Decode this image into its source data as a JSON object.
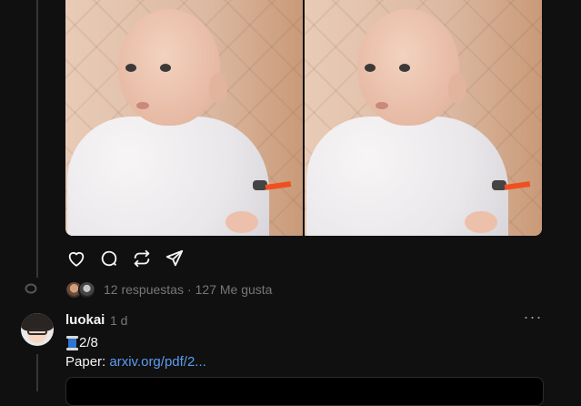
{
  "post": {
    "replies_text": "12 respuestas",
    "separator": "·",
    "likes_text": "127 Me gusta"
  },
  "actions": {
    "like_icon": "heart-icon",
    "reply_icon": "comment-icon",
    "repost_icon": "repost-icon",
    "share_icon": "send-icon"
  },
  "reply": {
    "username": "luokai",
    "time": "1 d",
    "more_icon": "more-icon",
    "more": "···",
    "thread_emoji": "spool-icon",
    "line1": "2/8",
    "paper_label": "Paper: ",
    "paper_link": "arxiv.org/pdf/2..."
  },
  "colors": {
    "background": "#101010",
    "muted_text": "#777777",
    "link": "#5b9cf2",
    "thread_line": "#333638"
  }
}
